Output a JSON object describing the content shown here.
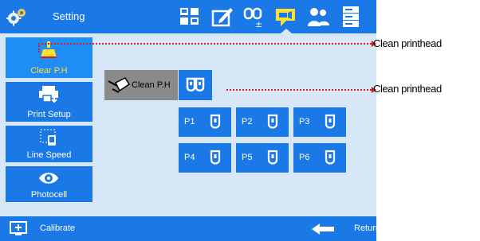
{
  "app": {
    "title": "Setting"
  },
  "topbar": {
    "icons": [
      "printhead-group-icon",
      "edit-icon",
      "printhead-switch-icon",
      "notice-icon",
      "users-icon",
      "storage-icon"
    ],
    "active": "notice-icon"
  },
  "menu": {
    "items": [
      {
        "label": "Clear P.H",
        "icon": "clean-brush-icon",
        "active": true
      },
      {
        "label": "Print Setup",
        "icon": "print-setup-icon"
      },
      {
        "label": "Line Speed",
        "icon": "line-speed-icon"
      },
      {
        "label": "Photocell",
        "icon": "photocell-icon"
      }
    ]
  },
  "clean": {
    "label": "Clean P.H",
    "all_button_icon": "printhead-pair-icon",
    "printheads": [
      {
        "label": "P1"
      },
      {
        "label": "P2"
      },
      {
        "label": "P3"
      },
      {
        "label": "P4"
      },
      {
        "label": "P5"
      },
      {
        "label": "P6"
      }
    ]
  },
  "bottombar": {
    "calibrate_label": "Calibrate",
    "return_label": "Return"
  },
  "callouts": {
    "first": "Clean printhead",
    "second": "Clean printhead"
  },
  "colors": {
    "bar_blue": "#1a79e6",
    "background": "#d6e7f7",
    "active_label": "#ffe033",
    "callout_line": "#d41c1c"
  }
}
